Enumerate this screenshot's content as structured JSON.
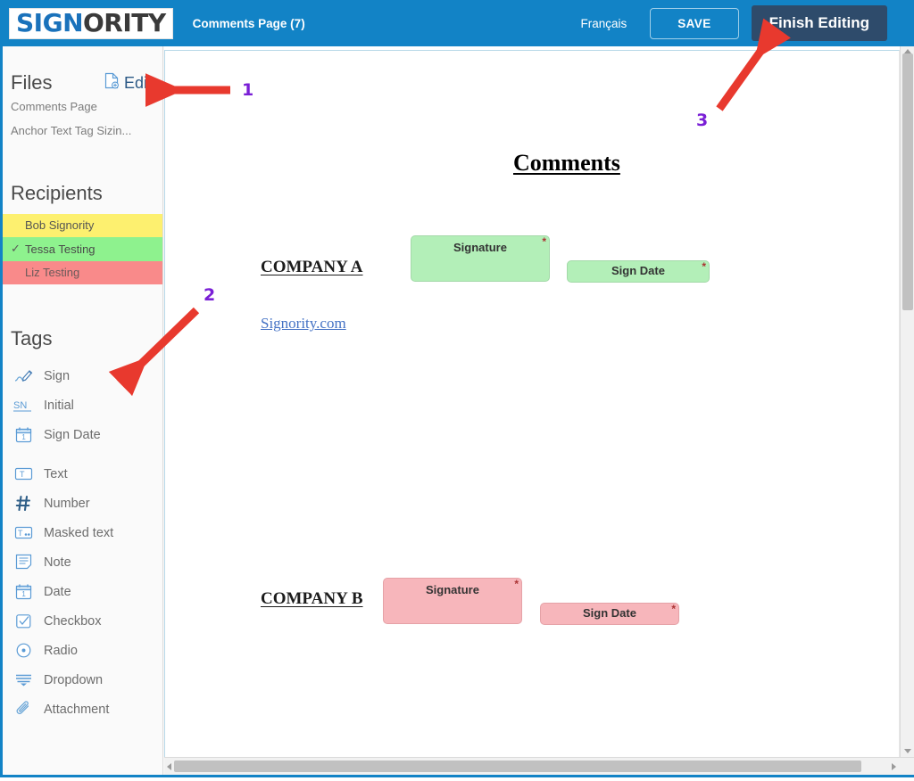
{
  "topbar": {
    "logo_part_a": "SIGN",
    "logo_part_b": "ORITY",
    "document_title": "Comments Page (7)",
    "language_label": "Français",
    "save_label": "SAVE",
    "finish_label": "Finish Editing",
    "bg_color": "#1283c6",
    "finish_bg_color": "#2e4b6b"
  },
  "sidebar": {
    "files": {
      "title": "Files",
      "edit_label": "Edit",
      "items": [
        {
          "label": "Comments Page"
        },
        {
          "label": "Anchor Text Tag Sizin..."
        }
      ]
    },
    "recipients": {
      "title": "Recipients",
      "items": [
        {
          "name": "Bob Signority",
          "color": "#fdf06f",
          "selected": false,
          "check": ""
        },
        {
          "name": "Tessa Testing",
          "color": "#8ef28e",
          "selected": true,
          "check": "✓"
        },
        {
          "name": "Liz Testing",
          "color": "#f98a8a",
          "selected": false,
          "check": ""
        }
      ]
    },
    "tags": {
      "title": "Tags",
      "items": [
        {
          "label": "Sign",
          "icon": "signature-pen-icon"
        },
        {
          "label": "Initial",
          "icon": "initials-sn-icon"
        },
        {
          "label": "Sign Date",
          "icon": "calendar-signdate-icon"
        },
        {
          "label": "Text",
          "icon": "text-field-icon"
        },
        {
          "label": "Number",
          "icon": "number-hash-icon"
        },
        {
          "label": "Masked text",
          "icon": "masked-text-icon"
        },
        {
          "label": "Note",
          "icon": "note-icon"
        },
        {
          "label": "Date",
          "icon": "calendar-date-icon"
        },
        {
          "label": "Checkbox",
          "icon": "checkbox-icon"
        },
        {
          "label": "Radio",
          "icon": "radio-icon"
        },
        {
          "label": "Dropdown",
          "icon": "dropdown-icon"
        },
        {
          "label": "Attachment",
          "icon": "paperclip-icon"
        }
      ]
    }
  },
  "document": {
    "heading": "Comments",
    "company_a": "COMPANY A",
    "company_b": "COMPANY B",
    "link": "Signority.com ",
    "tags": [
      {
        "label": "Signature",
        "required": "*",
        "color": "green"
      },
      {
        "label": "Sign Date",
        "required": "*",
        "color": "green"
      },
      {
        "label": "Signature",
        "required": "*",
        "color": "pink"
      },
      {
        "label": "Sign Date",
        "required": "*",
        "color": "pink"
      }
    ],
    "tag_green_color": "#b3efb8",
    "tag_pink_color": "#f7b6bb"
  },
  "annotations": {
    "color": "#e8392e",
    "number_color": "#7a1fd6",
    "items": [
      {
        "number": "1",
        "points_to": "edit-link"
      },
      {
        "number": "2",
        "points_to": "tags-section"
      },
      {
        "number": "3",
        "points_to": "finish-editing-button"
      }
    ]
  }
}
